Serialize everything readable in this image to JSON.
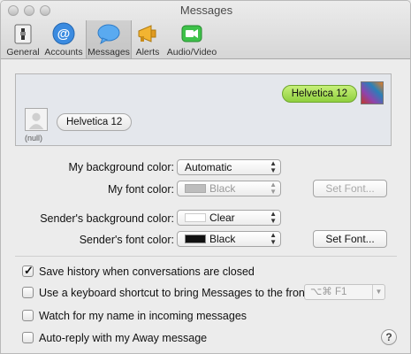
{
  "window": {
    "title": "Messages"
  },
  "toolbar": {
    "items": [
      {
        "label": "General",
        "icon": "switch-icon"
      },
      {
        "label": "Accounts",
        "icon": "at-icon"
      },
      {
        "label": "Messages",
        "icon": "speech-bubble-icon",
        "active": true
      },
      {
        "label": "Alerts",
        "icon": "megaphone-icon"
      },
      {
        "label": "Audio/Video",
        "icon": "video-camera-icon"
      }
    ]
  },
  "preview": {
    "my_bubble": "Helvetica 12",
    "sender_bubble": "Helvetica 12",
    "sender_name": "(null)"
  },
  "form": {
    "my_bg_label": "My background color:",
    "my_bg_value": "Automatic",
    "my_font_label": "My font color:",
    "my_font_value": "Black",
    "set_font_disabled": "Set Font...",
    "sender_bg_label": "Sender's background color:",
    "sender_bg_value": "Clear",
    "sender_font_label": "Sender's font color:",
    "sender_font_value": "Black",
    "set_font": "Set Font..."
  },
  "options": {
    "save_history": "Save history when conversations are closed",
    "keyboard_shortcut": "Use a keyboard shortcut to bring Messages to the front:",
    "shortcut_value": "⌥⌘ F1",
    "watch_name": "Watch for my name in incoming messages",
    "auto_reply": "Auto-reply with my Away message"
  },
  "help": "?",
  "colors": {
    "my_bubble": "#9fdc50",
    "sender_bubble": "#f2f2f2",
    "accent": "#2a7de1"
  }
}
